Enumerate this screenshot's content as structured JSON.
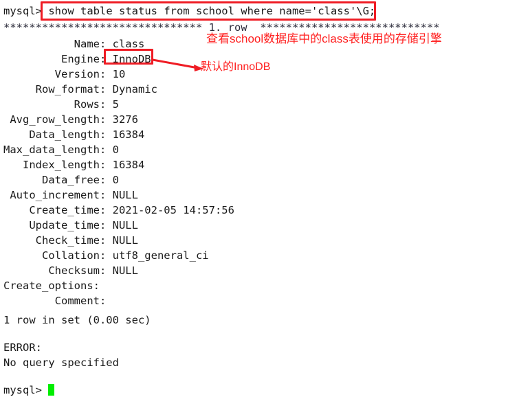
{
  "terminal": {
    "prompt": "mysql>",
    "command_line": {
      "prompt": "mysql>",
      "command": "show table status from school where name='class'\\G;"
    },
    "separator": {
      "left_stars": "*******************************",
      "row_label": "1. row",
      "right_stars": "****************************"
    },
    "fields": [
      {
        "label": "Name:",
        "value": "class"
      },
      {
        "label": "Engine:",
        "value": "InnoDB"
      },
      {
        "label": "Version:",
        "value": "10"
      },
      {
        "label": "Row_format:",
        "value": "Dynamic"
      },
      {
        "label": "Rows:",
        "value": "5"
      },
      {
        "label": "Avg_row_length:",
        "value": "3276"
      },
      {
        "label": "Data_length:",
        "value": "16384"
      },
      {
        "label": "Max_data_length:",
        "value": "0"
      },
      {
        "label": "Index_length:",
        "value": "16384"
      },
      {
        "label": "Data_free:",
        "value": "0"
      },
      {
        "label": "Auto_increment:",
        "value": "NULL"
      },
      {
        "label": "Create_time:",
        "value": "2021-02-05 14:57:56"
      },
      {
        "label": "Update_time:",
        "value": "NULL"
      },
      {
        "label": "Check_time:",
        "value": "NULL"
      },
      {
        "label": "Collation:",
        "value": "utf8_general_ci"
      },
      {
        "label": "Checksum:",
        "value": "NULL"
      },
      {
        "label": "Create_options:",
        "value": ""
      },
      {
        "label": "Comment:",
        "value": ""
      }
    ],
    "field_lines": [
      "           Name: class",
      "         Engine: InnoDB",
      "        Version: 10",
      "     Row_format: Dynamic",
      "           Rows: 5",
      " Avg_row_length: 3276",
      "    Data_length: 16384",
      "Max_data_length: 0",
      "   Index_length: 16384",
      "      Data_free: 0",
      " Auto_increment: NULL",
      "    Create_time: 2021-02-05 14:57:56",
      "    Update_time: NULL",
      "     Check_time: NULL",
      "      Collation: utf8_general_ci",
      "       Checksum: NULL",
      "Create_options: ",
      "        Comment: "
    ],
    "result_summary": "1 row in set (0.00 sec)",
    "error_header": "ERROR:",
    "error_message": "No query specified",
    "final_prompt": "mysql>"
  },
  "annotations": {
    "color": "#ef1c24",
    "command_highlight_label": "show table status from school where name='class'\\G;",
    "engine_highlight_label": "InnoDB",
    "note_purpose": "查看school数据库中的class表使用的存储引擎",
    "note_engine": "默认的InnoDB"
  }
}
